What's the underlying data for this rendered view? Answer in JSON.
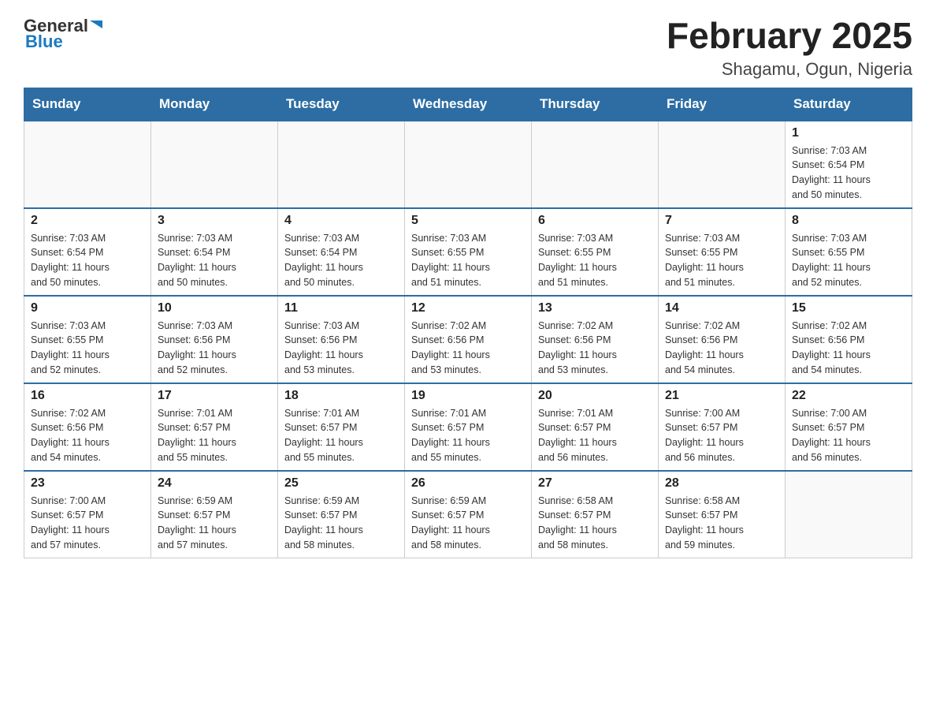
{
  "logo": {
    "text_general": "General",
    "text_blue": "Blue",
    "arrow_label": "general-blue-logo"
  },
  "header": {
    "month_year": "February 2025",
    "location": "Shagamu, Ogun, Nigeria"
  },
  "weekdays": [
    "Sunday",
    "Monday",
    "Tuesday",
    "Wednesday",
    "Thursday",
    "Friday",
    "Saturday"
  ],
  "weeks": [
    [
      {
        "day": "",
        "info": ""
      },
      {
        "day": "",
        "info": ""
      },
      {
        "day": "",
        "info": ""
      },
      {
        "day": "",
        "info": ""
      },
      {
        "day": "",
        "info": ""
      },
      {
        "day": "",
        "info": ""
      },
      {
        "day": "1",
        "info": "Sunrise: 7:03 AM\nSunset: 6:54 PM\nDaylight: 11 hours\nand 50 minutes."
      }
    ],
    [
      {
        "day": "2",
        "info": "Sunrise: 7:03 AM\nSunset: 6:54 PM\nDaylight: 11 hours\nand 50 minutes."
      },
      {
        "day": "3",
        "info": "Sunrise: 7:03 AM\nSunset: 6:54 PM\nDaylight: 11 hours\nand 50 minutes."
      },
      {
        "day": "4",
        "info": "Sunrise: 7:03 AM\nSunset: 6:54 PM\nDaylight: 11 hours\nand 50 minutes."
      },
      {
        "day": "5",
        "info": "Sunrise: 7:03 AM\nSunset: 6:55 PM\nDaylight: 11 hours\nand 51 minutes."
      },
      {
        "day": "6",
        "info": "Sunrise: 7:03 AM\nSunset: 6:55 PM\nDaylight: 11 hours\nand 51 minutes."
      },
      {
        "day": "7",
        "info": "Sunrise: 7:03 AM\nSunset: 6:55 PM\nDaylight: 11 hours\nand 51 minutes."
      },
      {
        "day": "8",
        "info": "Sunrise: 7:03 AM\nSunset: 6:55 PM\nDaylight: 11 hours\nand 52 minutes."
      }
    ],
    [
      {
        "day": "9",
        "info": "Sunrise: 7:03 AM\nSunset: 6:55 PM\nDaylight: 11 hours\nand 52 minutes."
      },
      {
        "day": "10",
        "info": "Sunrise: 7:03 AM\nSunset: 6:56 PM\nDaylight: 11 hours\nand 52 minutes."
      },
      {
        "day": "11",
        "info": "Sunrise: 7:03 AM\nSunset: 6:56 PM\nDaylight: 11 hours\nand 53 minutes."
      },
      {
        "day": "12",
        "info": "Sunrise: 7:02 AM\nSunset: 6:56 PM\nDaylight: 11 hours\nand 53 minutes."
      },
      {
        "day": "13",
        "info": "Sunrise: 7:02 AM\nSunset: 6:56 PM\nDaylight: 11 hours\nand 53 minutes."
      },
      {
        "day": "14",
        "info": "Sunrise: 7:02 AM\nSunset: 6:56 PM\nDaylight: 11 hours\nand 54 minutes."
      },
      {
        "day": "15",
        "info": "Sunrise: 7:02 AM\nSunset: 6:56 PM\nDaylight: 11 hours\nand 54 minutes."
      }
    ],
    [
      {
        "day": "16",
        "info": "Sunrise: 7:02 AM\nSunset: 6:56 PM\nDaylight: 11 hours\nand 54 minutes."
      },
      {
        "day": "17",
        "info": "Sunrise: 7:01 AM\nSunset: 6:57 PM\nDaylight: 11 hours\nand 55 minutes."
      },
      {
        "day": "18",
        "info": "Sunrise: 7:01 AM\nSunset: 6:57 PM\nDaylight: 11 hours\nand 55 minutes."
      },
      {
        "day": "19",
        "info": "Sunrise: 7:01 AM\nSunset: 6:57 PM\nDaylight: 11 hours\nand 55 minutes."
      },
      {
        "day": "20",
        "info": "Sunrise: 7:01 AM\nSunset: 6:57 PM\nDaylight: 11 hours\nand 56 minutes."
      },
      {
        "day": "21",
        "info": "Sunrise: 7:00 AM\nSunset: 6:57 PM\nDaylight: 11 hours\nand 56 minutes."
      },
      {
        "day": "22",
        "info": "Sunrise: 7:00 AM\nSunset: 6:57 PM\nDaylight: 11 hours\nand 56 minutes."
      }
    ],
    [
      {
        "day": "23",
        "info": "Sunrise: 7:00 AM\nSunset: 6:57 PM\nDaylight: 11 hours\nand 57 minutes."
      },
      {
        "day": "24",
        "info": "Sunrise: 6:59 AM\nSunset: 6:57 PM\nDaylight: 11 hours\nand 57 minutes."
      },
      {
        "day": "25",
        "info": "Sunrise: 6:59 AM\nSunset: 6:57 PM\nDaylight: 11 hours\nand 58 minutes."
      },
      {
        "day": "26",
        "info": "Sunrise: 6:59 AM\nSunset: 6:57 PM\nDaylight: 11 hours\nand 58 minutes."
      },
      {
        "day": "27",
        "info": "Sunrise: 6:58 AM\nSunset: 6:57 PM\nDaylight: 11 hours\nand 58 minutes."
      },
      {
        "day": "28",
        "info": "Sunrise: 6:58 AM\nSunset: 6:57 PM\nDaylight: 11 hours\nand 59 minutes."
      },
      {
        "day": "",
        "info": ""
      }
    ]
  ]
}
